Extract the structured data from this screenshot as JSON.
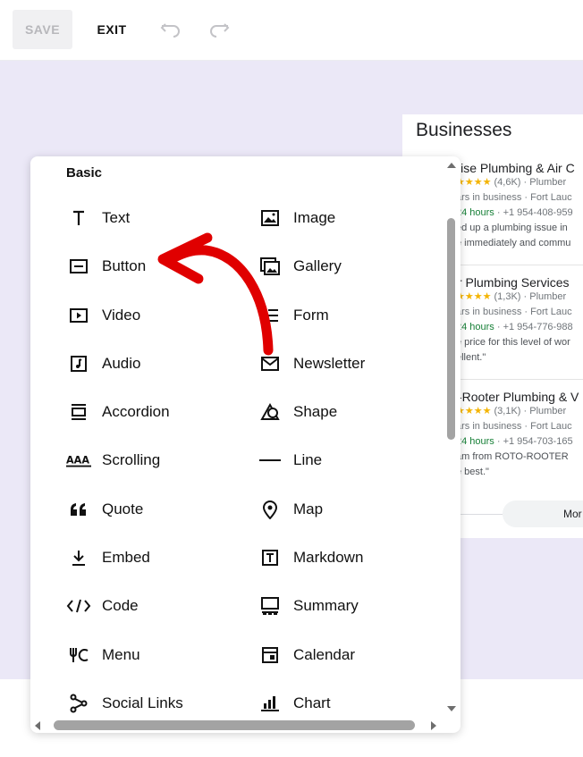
{
  "toolbar": {
    "save_label": "SAVE",
    "exit_label": "EXIT",
    "undo_icon": "undo-icon",
    "redo_icon": "redo-icon"
  },
  "businesses": {
    "title": "Businesses",
    "entries": [
      {
        "name": "lise Plumbing & Air C",
        "rating_line_stars": "★★★★",
        "rating_line_text": "(4,6K) · Plumber",
        "years": "ars in business · Fort Lauc",
        "hours": "24 hours",
        "phone": " · +1 954-408-959",
        "snippet1": "ed up a plumbing issue in",
        "snippet2": "e immediately and commu"
      },
      {
        "name": "r Plumbing Services",
        "rating_line_stars": "★★★★",
        "rating_line_text": "(1,3K) · Plumber",
        "years": "ars in business · Fort Lauc",
        "hours": "24 hours",
        "phone": " · +1 954-776-988",
        "snippet1": "e price for this level of wor",
        "snippet2": "ellent.\""
      },
      {
        "name": "-Rooter Plumbing & V",
        "rating_line_stars": "★★★★",
        "rating_line_text": "(3,1K) · Plumber",
        "years": "ars in business · Fort Lauc",
        "hours": "24 hours",
        "phone": " · +1 954-703-165",
        "snippet1": "am from ROTO-ROOTER",
        "snippet2": "e best.\""
      }
    ],
    "more_label": "Mor"
  },
  "panel": {
    "heading": "Basic",
    "left": [
      {
        "label": "Text",
        "icon": "text-icon"
      },
      {
        "label": "Button",
        "icon": "button-icon"
      },
      {
        "label": "Video",
        "icon": "video-icon"
      },
      {
        "label": "Audio",
        "icon": "audio-icon"
      },
      {
        "label": "Accordion",
        "icon": "accordion-icon"
      },
      {
        "label": "Scrolling",
        "icon": "scrolling-icon"
      },
      {
        "label": "Quote",
        "icon": "quote-icon"
      },
      {
        "label": "Embed",
        "icon": "embed-icon"
      },
      {
        "label": "Code",
        "icon": "code-icon"
      },
      {
        "label": "Menu",
        "icon": "menu-icon"
      },
      {
        "label": "Social Links",
        "icon": "social-links-icon"
      }
    ],
    "right": [
      {
        "label": "Image",
        "icon": "image-icon"
      },
      {
        "label": "Gallery",
        "icon": "gallery-icon"
      },
      {
        "label": "Form",
        "icon": "form-icon"
      },
      {
        "label": "Newsletter",
        "icon": "newsletter-icon"
      },
      {
        "label": "Shape",
        "icon": "shape-icon"
      },
      {
        "label": "Line",
        "icon": "line-icon"
      },
      {
        "label": "Map",
        "icon": "map-icon"
      },
      {
        "label": "Markdown",
        "icon": "markdown-icon"
      },
      {
        "label": "Summary",
        "icon": "summary-icon"
      },
      {
        "label": "Calendar",
        "icon": "calendar-icon"
      },
      {
        "label": "Chart",
        "icon": "chart-icon"
      }
    ]
  },
  "colors": {
    "canvas_bg": "#ebe8f7",
    "annotation_arrow": "#e00000"
  }
}
